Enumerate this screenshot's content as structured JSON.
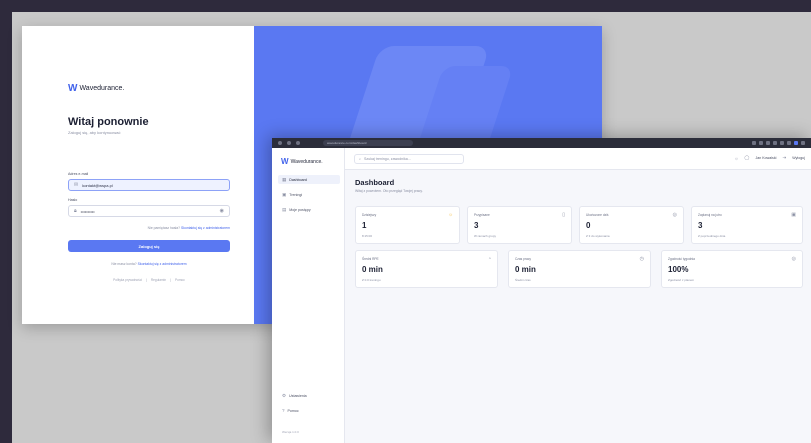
{
  "login": {
    "brand_mark": "W",
    "brand_name": "Wavedurance.",
    "title": "Witaj ponownie",
    "subtitle": "Zaloguj się, aby kontynuować",
    "email_label": "Adres e-mail",
    "email_value": "kontakt@wspa.pl",
    "password_label": "Hasło",
    "password_value": "••••••••••",
    "forgot_prefix": "Nie pamiętasz hasła?",
    "forgot_link": "Skontaktuj się z administratorem",
    "submit_label": "Zaloguj się",
    "register_prefix": "Nie masz konta?",
    "register_link": "Skontaktuj się z administratorem",
    "footer": [
      "Polityka prywatności",
      "|",
      "Regulamin",
      "|",
      "Pomoc"
    ]
  },
  "browser": {
    "url": "wavedurance.com/dashboard"
  },
  "dashboard": {
    "brand_mark": "W",
    "brand_name": "Wavedurance.",
    "search_placeholder": "Szukaj treningu, zawodnika...",
    "user_name": "Jan Kowalski",
    "logout_label": "Wyloguj",
    "nav": [
      {
        "label": "Dashboard",
        "icon": "grid-icon"
      },
      {
        "label": "Treningi",
        "icon": "calendar-icon"
      },
      {
        "label": "Moje postępy",
        "icon": "chart-icon"
      }
    ],
    "nav_bottom": [
      {
        "label": "Ustawienia",
        "icon": "gear-icon"
      },
      {
        "label": "Pomoc",
        "icon": "help-icon"
      }
    ],
    "version": "Wersja 1.0.0",
    "title": "Dashboard",
    "subtitle": "Witaj z powrotem. Oto przegląd Twojej pracy.",
    "cards_row1": [
      {
        "title": "Dzisiejszy",
        "value": "1",
        "sub": "8:15:00",
        "icon": "sun-icon"
      },
      {
        "title": "Przypisane",
        "value": "3",
        "sub": "W ramach grupy",
        "icon": "document-icon"
      },
      {
        "title": "Ukończone dziś",
        "value": "0",
        "sub": "Z 3 do wykonania",
        "icon": "check-icon"
      },
      {
        "title": "Zaplanuj na jutro",
        "value": "3",
        "sub": "Z poprzedniego dnia",
        "icon": "calendar-icon"
      }
    ],
    "cards_row2": [
      {
        "title": "Średni RPE",
        "value": "0 min",
        "sub": "Z 0.0 treningu",
        "icon": "gauge-icon"
      },
      {
        "title": "Czas pracy",
        "value": "0 min",
        "sub": "Średni czas",
        "icon": "clock-icon"
      },
      {
        "title": "Zgodność tygodnia",
        "value": "100%",
        "sub": "Zgodność z planem",
        "icon": "target-icon"
      }
    ]
  }
}
